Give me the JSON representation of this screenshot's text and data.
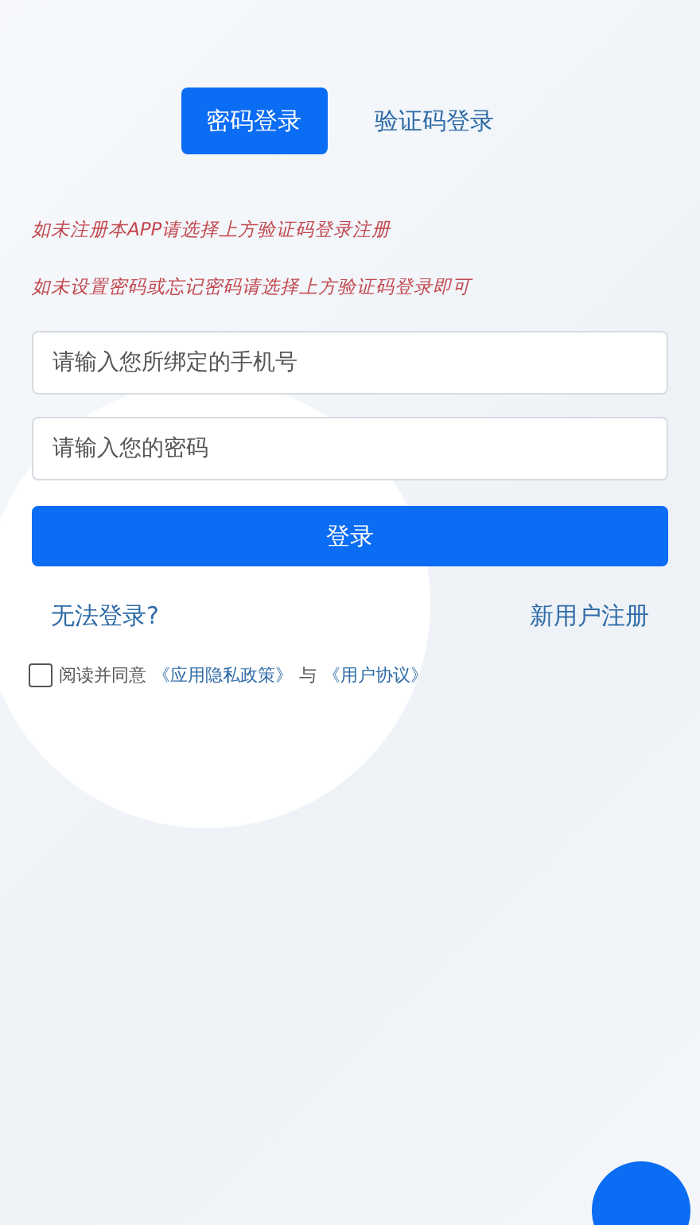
{
  "tabs": [
    {
      "label": "密码登录",
      "selected": true
    },
    {
      "label": "验证码登录",
      "selected": false
    }
  ],
  "notices": [
    "如未注册本APP请选择上方验证码登录注册",
    "如未设置密码或忘记密码请选择上方验证码登录即可"
  ],
  "fields": [
    {
      "placeholder": "请输入您所绑定的手机号"
    },
    {
      "placeholder": "请输入您的密码"
    }
  ],
  "login_button": "登录",
  "links": {
    "cannot_login": "无法登录?",
    "register": "新用户注册"
  },
  "agreement": {
    "checked": false,
    "prefix": "阅读并同意",
    "privacy_link": "《应用隐私政策》",
    "conjunction": "与",
    "terms_link": "《用户协议》"
  }
}
